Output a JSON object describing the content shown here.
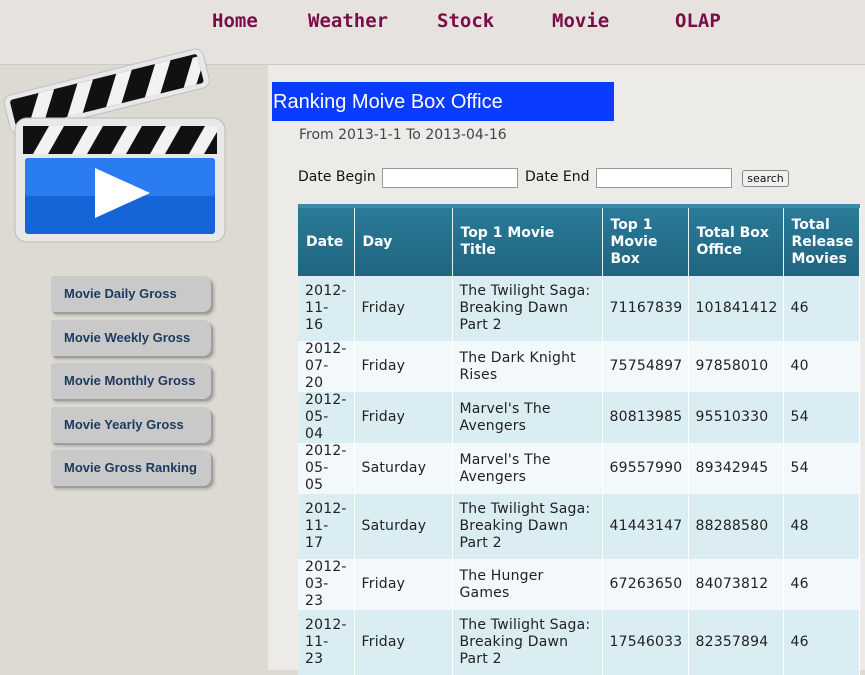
{
  "nav": {
    "items": [
      "Home",
      "Weather",
      "Stock",
      "Movie",
      "OLAP"
    ]
  },
  "sidebar": {
    "items": [
      "Movie Daily Gross",
      "Movie Weekly Gross",
      "Movie Monthly Gross",
      "Movie Yearly Gross",
      "Movie Gross Ranking"
    ]
  },
  "main": {
    "title": "Ranking Moive Box Office",
    "date_range": "From 2013-1-1 To 2013-04-16",
    "date_begin_label": "Date Begin",
    "date_begin_value": "",
    "date_end_label": "Date End",
    "date_end_value": "",
    "search_label": "search"
  },
  "table": {
    "headers": [
      "Date",
      "Day",
      "Top 1 Movie Title",
      "Top 1 Movie Box",
      "Total Box Office",
      "Total Release Movies"
    ],
    "rows": [
      [
        "2012-11-16",
        "Friday",
        "The Twilight Saga: Breaking Dawn Part 2",
        "71167839",
        "101841412",
        "46"
      ],
      [
        "2012-07-20",
        "Friday",
        "The Dark Knight Rises",
        "75754897",
        "97858010",
        "40"
      ],
      [
        "2012-05-04",
        "Friday",
        "Marvel's The Avengers",
        "80813985",
        "95510330",
        "54"
      ],
      [
        "2012-05-05",
        "Saturday",
        "Marvel's The Avengers",
        "69557990",
        "89342945",
        "54"
      ],
      [
        "2012-11-17",
        "Saturday",
        "The Twilight Saga: Breaking Dawn Part 2",
        "41443147",
        "88288580",
        "48"
      ],
      [
        "2012-03-23",
        "Friday",
        "The Hunger Games",
        "67263650",
        "84073812",
        "46"
      ],
      [
        "2012-11-23",
        "Friday",
        "The Twilight Saga: Breaking Dawn Part 2",
        "17546033",
        "82357894",
        "46"
      ]
    ]
  },
  "colors": {
    "nav_text": "#7b0c48",
    "title_bg": "#0a3cff",
    "table_header": "#1f6580",
    "row_odd": "#d9edf2",
    "row_even": "#f3f9fa"
  },
  "icons": {
    "logo": "video-clapperboard-icon"
  }
}
